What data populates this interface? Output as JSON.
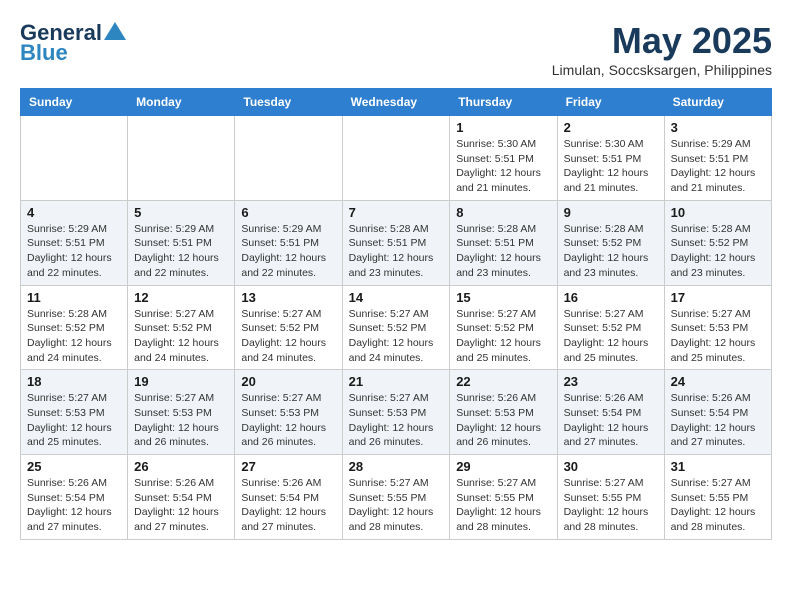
{
  "logo": {
    "line1": "General",
    "line2": "Blue"
  },
  "title": {
    "month_year": "May 2025",
    "location": "Limulan, Soccsksargen, Philippines"
  },
  "days_of_week": [
    "Sunday",
    "Monday",
    "Tuesday",
    "Wednesday",
    "Thursday",
    "Friday",
    "Saturday"
  ],
  "weeks": [
    [
      {
        "day": "",
        "info": ""
      },
      {
        "day": "",
        "info": ""
      },
      {
        "day": "",
        "info": ""
      },
      {
        "day": "",
        "info": ""
      },
      {
        "day": "1",
        "info": "Sunrise: 5:30 AM\nSunset: 5:51 PM\nDaylight: 12 hours and 21 minutes."
      },
      {
        "day": "2",
        "info": "Sunrise: 5:30 AM\nSunset: 5:51 PM\nDaylight: 12 hours and 21 minutes."
      },
      {
        "day": "3",
        "info": "Sunrise: 5:29 AM\nSunset: 5:51 PM\nDaylight: 12 hours and 21 minutes."
      }
    ],
    [
      {
        "day": "4",
        "info": "Sunrise: 5:29 AM\nSunset: 5:51 PM\nDaylight: 12 hours and 22 minutes."
      },
      {
        "day": "5",
        "info": "Sunrise: 5:29 AM\nSunset: 5:51 PM\nDaylight: 12 hours and 22 minutes."
      },
      {
        "day": "6",
        "info": "Sunrise: 5:29 AM\nSunset: 5:51 PM\nDaylight: 12 hours and 22 minutes."
      },
      {
        "day": "7",
        "info": "Sunrise: 5:28 AM\nSunset: 5:51 PM\nDaylight: 12 hours and 23 minutes."
      },
      {
        "day": "8",
        "info": "Sunrise: 5:28 AM\nSunset: 5:51 PM\nDaylight: 12 hours and 23 minutes."
      },
      {
        "day": "9",
        "info": "Sunrise: 5:28 AM\nSunset: 5:52 PM\nDaylight: 12 hours and 23 minutes."
      },
      {
        "day": "10",
        "info": "Sunrise: 5:28 AM\nSunset: 5:52 PM\nDaylight: 12 hours and 23 minutes."
      }
    ],
    [
      {
        "day": "11",
        "info": "Sunrise: 5:28 AM\nSunset: 5:52 PM\nDaylight: 12 hours and 24 minutes."
      },
      {
        "day": "12",
        "info": "Sunrise: 5:27 AM\nSunset: 5:52 PM\nDaylight: 12 hours and 24 minutes."
      },
      {
        "day": "13",
        "info": "Sunrise: 5:27 AM\nSunset: 5:52 PM\nDaylight: 12 hours and 24 minutes."
      },
      {
        "day": "14",
        "info": "Sunrise: 5:27 AM\nSunset: 5:52 PM\nDaylight: 12 hours and 24 minutes."
      },
      {
        "day": "15",
        "info": "Sunrise: 5:27 AM\nSunset: 5:52 PM\nDaylight: 12 hours and 25 minutes."
      },
      {
        "day": "16",
        "info": "Sunrise: 5:27 AM\nSunset: 5:52 PM\nDaylight: 12 hours and 25 minutes."
      },
      {
        "day": "17",
        "info": "Sunrise: 5:27 AM\nSunset: 5:53 PM\nDaylight: 12 hours and 25 minutes."
      }
    ],
    [
      {
        "day": "18",
        "info": "Sunrise: 5:27 AM\nSunset: 5:53 PM\nDaylight: 12 hours and 25 minutes."
      },
      {
        "day": "19",
        "info": "Sunrise: 5:27 AM\nSunset: 5:53 PM\nDaylight: 12 hours and 26 minutes."
      },
      {
        "day": "20",
        "info": "Sunrise: 5:27 AM\nSunset: 5:53 PM\nDaylight: 12 hours and 26 minutes."
      },
      {
        "day": "21",
        "info": "Sunrise: 5:27 AM\nSunset: 5:53 PM\nDaylight: 12 hours and 26 minutes."
      },
      {
        "day": "22",
        "info": "Sunrise: 5:26 AM\nSunset: 5:53 PM\nDaylight: 12 hours and 26 minutes."
      },
      {
        "day": "23",
        "info": "Sunrise: 5:26 AM\nSunset: 5:54 PM\nDaylight: 12 hours and 27 minutes."
      },
      {
        "day": "24",
        "info": "Sunrise: 5:26 AM\nSunset: 5:54 PM\nDaylight: 12 hours and 27 minutes."
      }
    ],
    [
      {
        "day": "25",
        "info": "Sunrise: 5:26 AM\nSunset: 5:54 PM\nDaylight: 12 hours and 27 minutes."
      },
      {
        "day": "26",
        "info": "Sunrise: 5:26 AM\nSunset: 5:54 PM\nDaylight: 12 hours and 27 minutes."
      },
      {
        "day": "27",
        "info": "Sunrise: 5:26 AM\nSunset: 5:54 PM\nDaylight: 12 hours and 27 minutes."
      },
      {
        "day": "28",
        "info": "Sunrise: 5:27 AM\nSunset: 5:55 PM\nDaylight: 12 hours and 28 minutes."
      },
      {
        "day": "29",
        "info": "Sunrise: 5:27 AM\nSunset: 5:55 PM\nDaylight: 12 hours and 28 minutes."
      },
      {
        "day": "30",
        "info": "Sunrise: 5:27 AM\nSunset: 5:55 PM\nDaylight: 12 hours and 28 minutes."
      },
      {
        "day": "31",
        "info": "Sunrise: 5:27 AM\nSunset: 5:55 PM\nDaylight: 12 hours and 28 minutes."
      }
    ]
  ]
}
